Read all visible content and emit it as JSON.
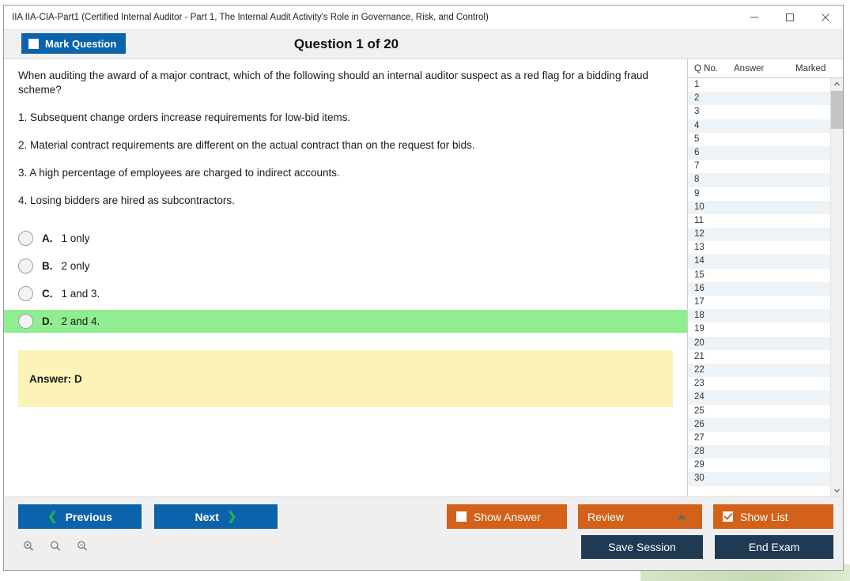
{
  "window": {
    "title": "IIA IIA-CIA-Part1 (Certified Internal Auditor - Part 1, The Internal Audit Activity's Role in Governance, Risk, and Control)",
    "minimize_label": "Minimize",
    "maximize_label": "Maximize",
    "close_label": "Close"
  },
  "toolbar": {
    "mark_question_label": "Mark Question",
    "mark_question_checked": false,
    "question_counter": "Question 1 of 20"
  },
  "question": {
    "prompt": "When auditing the award of a major contract, which of the following should an internal auditor suspect as a red flag for a bidding fraud scheme?",
    "statements": [
      "1. Subsequent change orders increase requirements for low-bid items.",
      "2. Material contract requirements are different on the actual contract than on the request for bids.",
      "3. A high percentage of employees are charged to indirect accounts.",
      "4. Losing bidders are hired as subcontractors."
    ],
    "options": [
      {
        "letter": "A.",
        "text": "1 only",
        "correct": false,
        "selected": false
      },
      {
        "letter": "B.",
        "text": "2 only",
        "correct": false,
        "selected": false
      },
      {
        "letter": "C.",
        "text": "1 and 3.",
        "correct": false,
        "selected": false
      },
      {
        "letter": "D.",
        "text": "2 and 4.",
        "correct": true,
        "selected": false
      }
    ],
    "answer_label": "Answer: D"
  },
  "list_panel": {
    "headers": {
      "q_no": "Q No.",
      "answer": "Answer",
      "marked": "Marked"
    },
    "rows": [
      {
        "q_no": "1",
        "answer": "",
        "marked": ""
      },
      {
        "q_no": "2",
        "answer": "",
        "marked": ""
      },
      {
        "q_no": "3",
        "answer": "",
        "marked": ""
      },
      {
        "q_no": "4",
        "answer": "",
        "marked": ""
      },
      {
        "q_no": "5",
        "answer": "",
        "marked": ""
      },
      {
        "q_no": "6",
        "answer": "",
        "marked": ""
      },
      {
        "q_no": "7",
        "answer": "",
        "marked": ""
      },
      {
        "q_no": "8",
        "answer": "",
        "marked": ""
      },
      {
        "q_no": "9",
        "answer": "",
        "marked": ""
      },
      {
        "q_no": "10",
        "answer": "",
        "marked": ""
      },
      {
        "q_no": "11",
        "answer": "",
        "marked": ""
      },
      {
        "q_no": "12",
        "answer": "",
        "marked": ""
      },
      {
        "q_no": "13",
        "answer": "",
        "marked": ""
      },
      {
        "q_no": "14",
        "answer": "",
        "marked": ""
      },
      {
        "q_no": "15",
        "answer": "",
        "marked": ""
      },
      {
        "q_no": "16",
        "answer": "",
        "marked": ""
      },
      {
        "q_no": "17",
        "answer": "",
        "marked": ""
      },
      {
        "q_no": "18",
        "answer": "",
        "marked": ""
      },
      {
        "q_no": "19",
        "answer": "",
        "marked": ""
      },
      {
        "q_no": "20",
        "answer": "",
        "marked": ""
      },
      {
        "q_no": "21",
        "answer": "",
        "marked": ""
      },
      {
        "q_no": "22",
        "answer": "",
        "marked": ""
      },
      {
        "q_no": "23",
        "answer": "",
        "marked": ""
      },
      {
        "q_no": "24",
        "answer": "",
        "marked": ""
      },
      {
        "q_no": "25",
        "answer": "",
        "marked": ""
      },
      {
        "q_no": "26",
        "answer": "",
        "marked": ""
      },
      {
        "q_no": "27",
        "answer": "",
        "marked": ""
      },
      {
        "q_no": "28",
        "answer": "",
        "marked": ""
      },
      {
        "q_no": "29",
        "answer": "",
        "marked": ""
      },
      {
        "q_no": "30",
        "answer": "",
        "marked": ""
      }
    ]
  },
  "footer": {
    "previous_label": "Previous",
    "next_label": "Next",
    "show_answer_label": "Show Answer",
    "show_answer_checked": false,
    "review_label": "Review",
    "show_list_label": "Show List",
    "show_list_checked": true,
    "save_session_label": "Save Session",
    "end_exam_label": "End Exam",
    "zoom_in_label": "Zoom In",
    "zoom_reset_label": "Zoom Reset",
    "zoom_out_label": "Zoom Out"
  },
  "colors": {
    "primary_blue": "#0b63ac",
    "orange": "#d4611a",
    "dark_navy": "#1f3a52",
    "correct_green": "#90ee90",
    "answer_yellow": "#fbf3b8",
    "chevron_green": "#22b14c"
  }
}
